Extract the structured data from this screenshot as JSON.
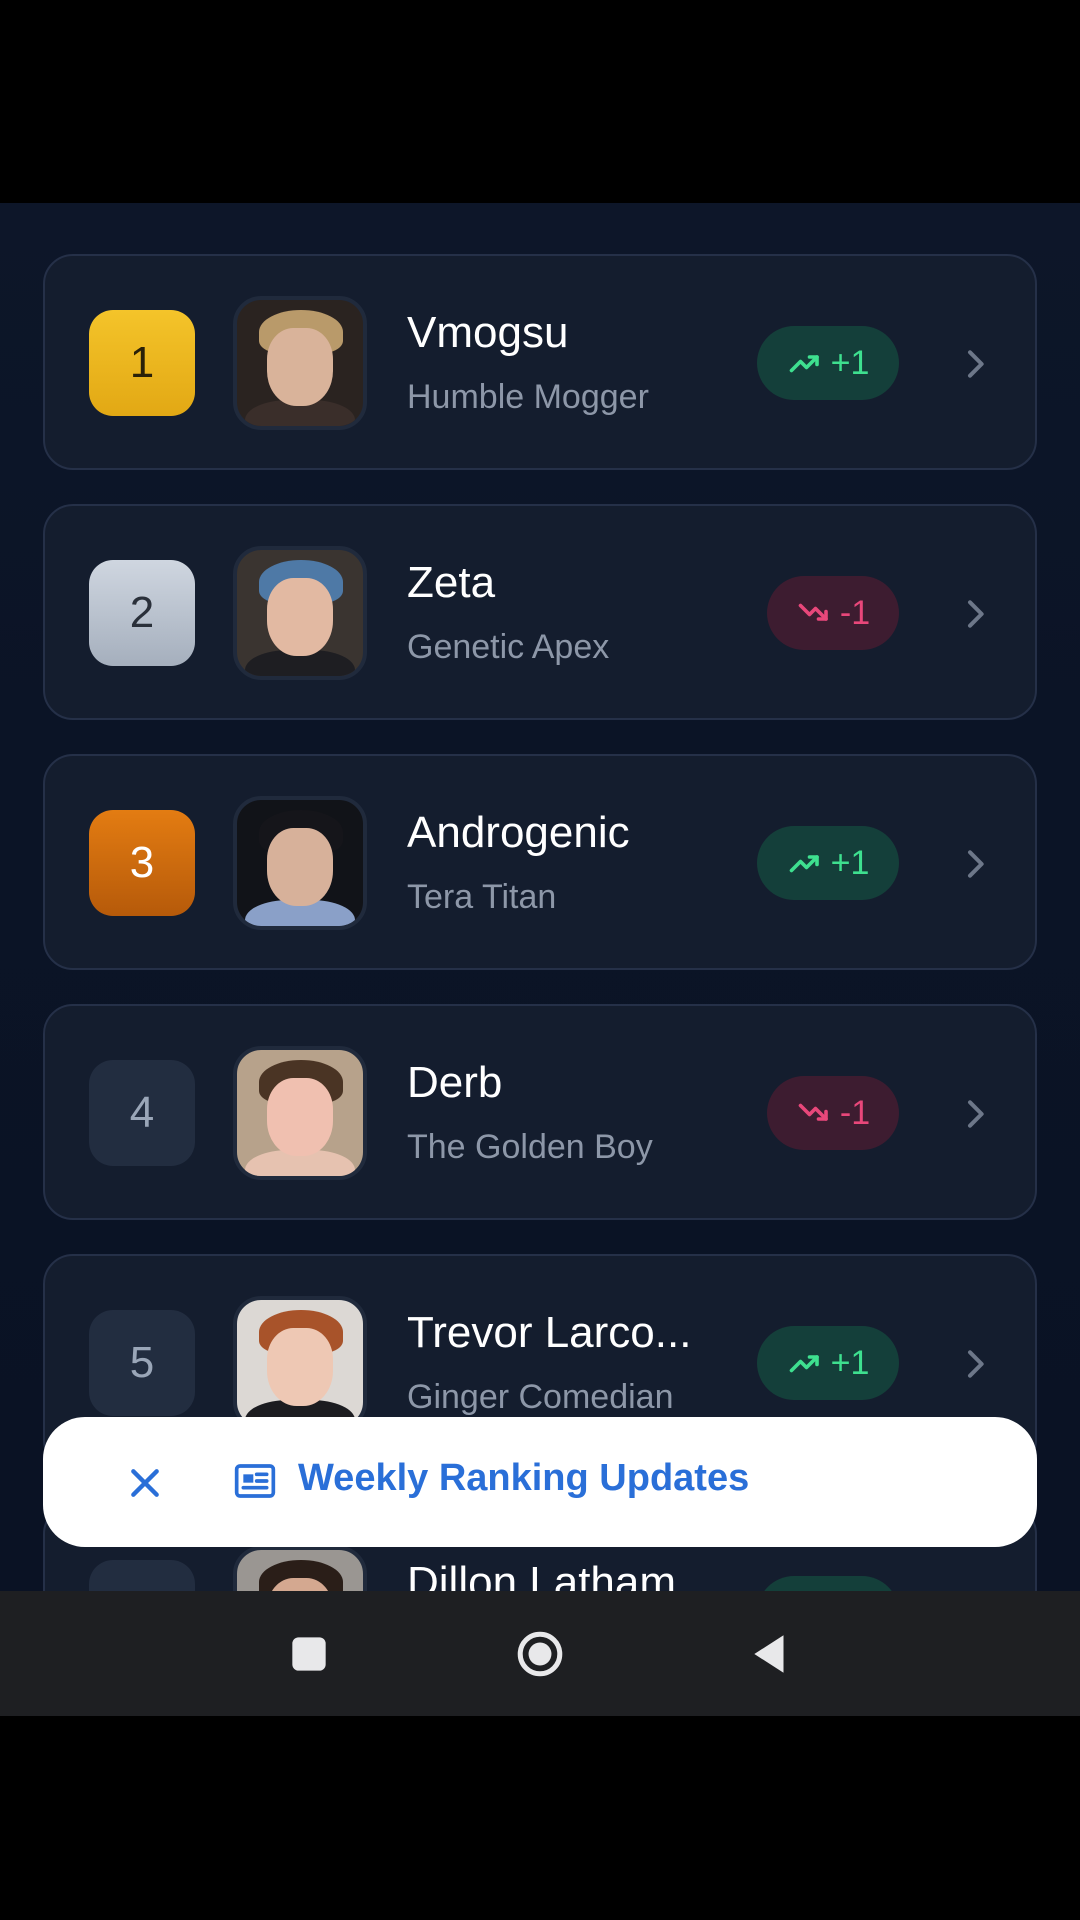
{
  "leaderboard": {
    "entries": [
      {
        "rank": "1",
        "name": "Vmogsu",
        "title": "Humble Mogger",
        "change": "+1",
        "direction": "up"
      },
      {
        "rank": "2",
        "name": "Zeta",
        "title": "Genetic Apex",
        "change": "-1",
        "direction": "down"
      },
      {
        "rank": "3",
        "name": "Androgenic",
        "title": "Tera Titan",
        "change": "+1",
        "direction": "up"
      },
      {
        "rank": "4",
        "name": "Derb",
        "title": "The Golden Boy",
        "change": "-1",
        "direction": "down"
      },
      {
        "rank": "5",
        "name": "Trevor Larco...",
        "title": "Ginger Comedian",
        "change": "+1",
        "direction": "up"
      },
      {
        "rank": "",
        "name": "Dillon Latham",
        "title": "",
        "change": "",
        "direction": "up"
      }
    ]
  },
  "toast": {
    "label": "Weekly Ranking Updates"
  },
  "colors": {
    "up": "#3ee08f",
    "down": "#e8477a",
    "gold": "#f4c42a",
    "silver": "#cfd6e0",
    "bronze": "#e37c12",
    "toast_text": "#2a6fd8"
  },
  "icons": {
    "trend_up": "trending-up-icon",
    "trend_down": "trending-down-icon",
    "chevron": "chevron-right-icon",
    "close": "close-icon",
    "news": "newspaper-icon",
    "nav_recents": "square-icon",
    "nav_home": "circle-icon",
    "nav_back": "triangle-back-icon"
  }
}
